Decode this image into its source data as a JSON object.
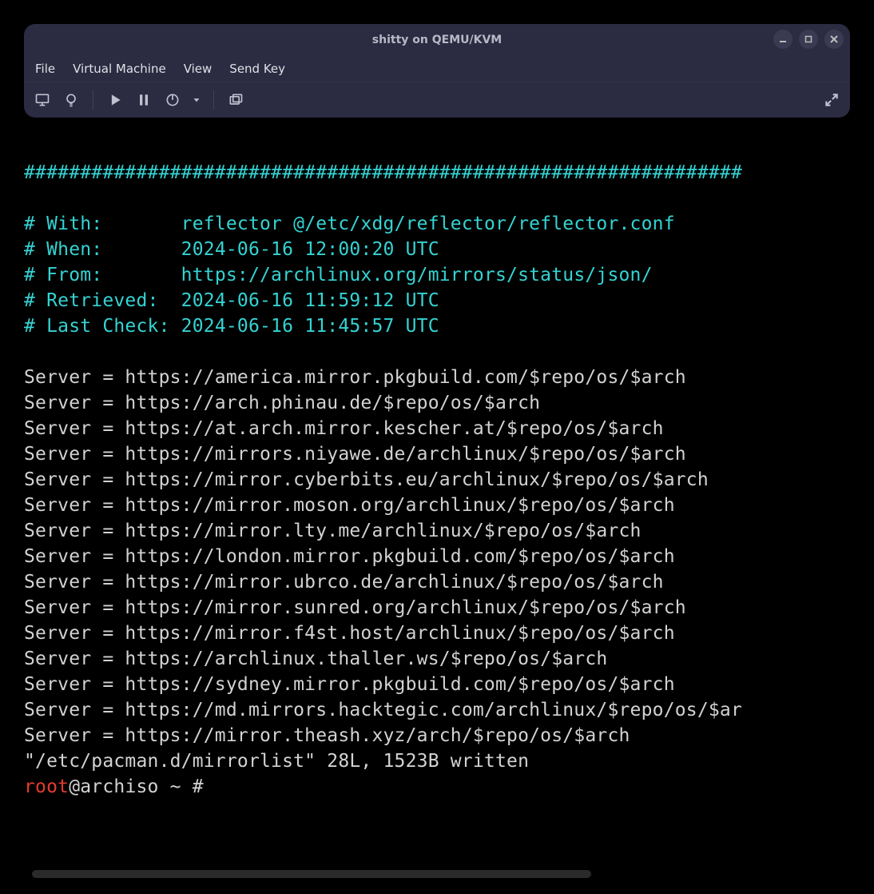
{
  "window": {
    "title": "shitty on QEMU/KVM"
  },
  "menubar": {
    "file": "File",
    "vm": "Virtual Machine",
    "view": "View",
    "sendkey": "Send Key"
  },
  "terminal": {
    "hashline": "################################################################",
    "header": {
      "with_k": "# With:       ",
      "with_v": "reflector @/etc/xdg/reflector/reflector.conf",
      "when_k": "# When:       ",
      "when_v": "2024-06-16 12:00:20 UTC",
      "from_k": "# From:       ",
      "from_v": "https://archlinux.org/mirrors/status/json/",
      "retrieved_k": "# Retrieved:  ",
      "retrieved_v": "2024-06-16 11:59:12 UTC",
      "lastcheck_k": "# Last Check: ",
      "lastcheck_v": "2024-06-16 11:45:57 UTC"
    },
    "servers": [
      "Server = https://america.mirror.pkgbuild.com/$repo/os/$arch",
      "Server = https://arch.phinau.de/$repo/os/$arch",
      "Server = https://at.arch.mirror.kescher.at/$repo/os/$arch",
      "Server = https://mirrors.niyawe.de/archlinux/$repo/os/$arch",
      "Server = https://mirror.cyberbits.eu/archlinux/$repo/os/$arch",
      "Server = https://mirror.moson.org/archlinux/$repo/os/$arch",
      "Server = https://mirror.lty.me/archlinux/$repo/os/$arch",
      "Server = https://london.mirror.pkgbuild.com/$repo/os/$arch",
      "Server = https://mirror.ubrco.de/archlinux/$repo/os/$arch",
      "Server = https://mirror.sunred.org/archlinux/$repo/os/$arch",
      "Server = https://mirror.f4st.host/archlinux/$repo/os/$arch",
      "Server = https://archlinux.thaller.ws/$repo/os/$arch",
      "Server = https://sydney.mirror.pkgbuild.com/$repo/os/$arch",
      "Server = https://md.mirrors.hacktegic.com/archlinux/$repo/os/$ar",
      "Server = https://mirror.theash.xyz/arch/$repo/os/$arch"
    ],
    "written": "\"/etc/pacman.d/mirrorlist\" 28L, 1523B written",
    "prompt_user": "root",
    "prompt_rest": "@archiso ~ # "
  }
}
